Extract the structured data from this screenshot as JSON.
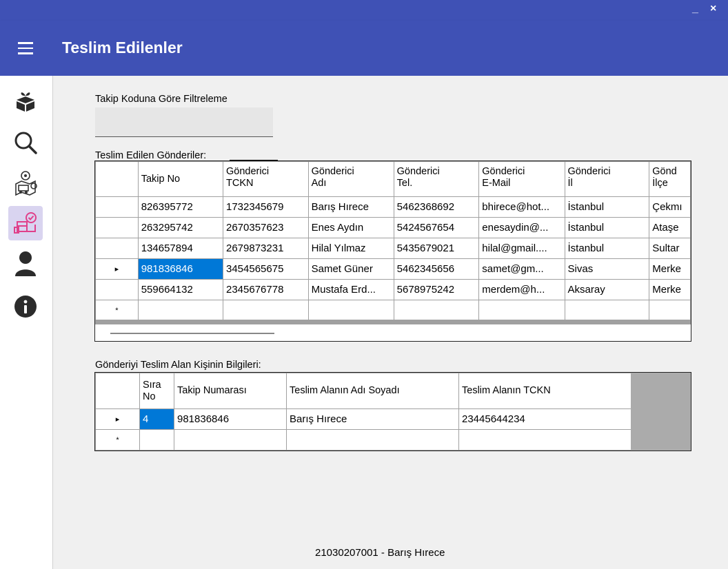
{
  "window": {
    "minimize_label": "_",
    "close_label": "×"
  },
  "app": {
    "title": "Teslim Edilenler"
  },
  "sidebar": {
    "items": [
      {
        "icon": "package-icon"
      },
      {
        "icon": "search-icon"
      },
      {
        "icon": "delivery-map-icon"
      },
      {
        "icon": "delivered-icon",
        "active": true
      },
      {
        "icon": "user-icon"
      },
      {
        "icon": "info-icon"
      }
    ]
  },
  "filter": {
    "label": "Takip Koduna Göre Filtreleme",
    "value": ""
  },
  "shipments": {
    "label": "Teslim Edilen Gönderiler:",
    "headers": [
      [
        "Takip No",
        ""
      ],
      [
        "Gönderici",
        "TCKN"
      ],
      [
        "Gönderici",
        "Adı"
      ],
      [
        "Gönderici",
        "Tel."
      ],
      [
        "Gönderici",
        "E-Mail"
      ],
      [
        "Gönderici",
        "İl"
      ],
      [
        "Gönd",
        "İlçe"
      ]
    ],
    "rows": [
      {
        "indicator": "",
        "cells": [
          "826395772",
          "1732345679",
          "Barış Hırece",
          "5462368692",
          "bhirece@hot...",
          "İstanbul",
          "Çekmı"
        ]
      },
      {
        "indicator": "",
        "cells": [
          "263295742",
          "2670357623",
          "Enes Aydın",
          "5424567654",
          "enesaydin@...",
          "İstanbul",
          "Ataşe"
        ]
      },
      {
        "indicator": "",
        "cells": [
          "134657894",
          "2679873231",
          "Hilal Yılmaz",
          "5435679021",
          "hilal@gmail....",
          "İstanbul",
          "Sultar"
        ]
      },
      {
        "indicator": "▸",
        "selected": true,
        "cells": [
          "981836846",
          "3454565675",
          "Samet Güner",
          "5462345656",
          "samet@gm...",
          "Sivas",
          "Merke"
        ]
      },
      {
        "indicator": "",
        "cells": [
          "559664132",
          "2345676778",
          "Mustafa Erd...",
          "5678975242",
          "merdem@h...",
          "Aksaray",
          "Merke"
        ]
      },
      {
        "indicator": "*",
        "cells": [
          "",
          "",
          "",
          "",
          "",
          "",
          ""
        ]
      }
    ]
  },
  "receiver": {
    "label": "Gönderiyi Teslim Alan Kişinin Bilgileri:",
    "headers": [
      [
        "Sıra",
        "No"
      ],
      [
        "Takip Numarası",
        ""
      ],
      [
        "Teslim Alanın Adı Soyadı",
        ""
      ],
      [
        "Teslim Alanın TCKN",
        ""
      ]
    ],
    "rows": [
      {
        "indicator": "▸",
        "selected": true,
        "cells": [
          "4",
          "981836846",
          "Barış Hırece",
          "23445644234"
        ]
      },
      {
        "indicator": "*",
        "cells": [
          "",
          "",
          "",
          ""
        ]
      }
    ]
  },
  "footer": {
    "text": "21030207001 - Barış Hırece"
  },
  "colors": {
    "appbar": "#3f51b5",
    "selection": "#0078d7",
    "active_nav": "#d9d4f0"
  }
}
